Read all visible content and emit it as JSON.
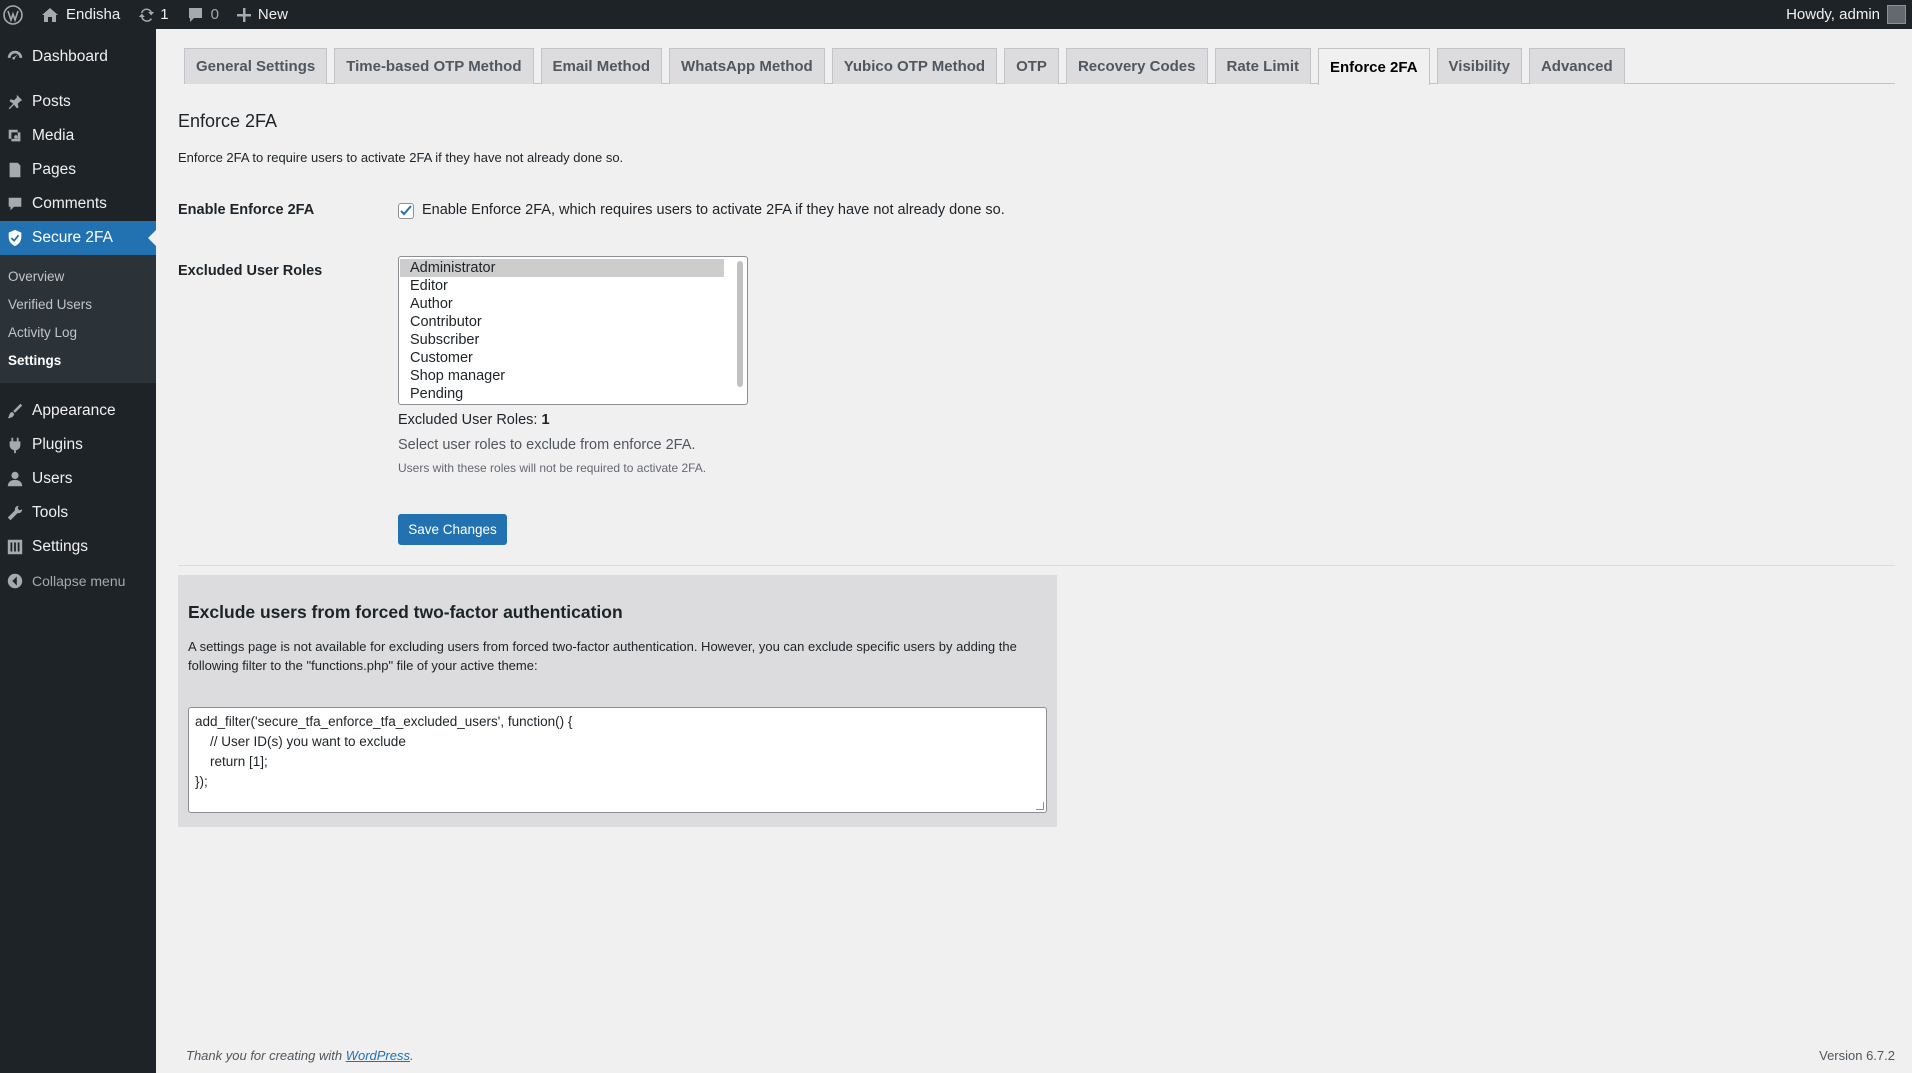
{
  "adminbar": {
    "site_name": "Endisha",
    "updates_count": "1",
    "comments_count": "0",
    "new_label": "New",
    "howdy": "Howdy, admin"
  },
  "sidebar": {
    "dashboard": "Dashboard",
    "posts": "Posts",
    "media": "Media",
    "pages": "Pages",
    "comments": "Comments",
    "secure2fa": "Secure 2FA",
    "sub": [
      "Overview",
      "Verified Users",
      "Activity Log",
      "Settings"
    ],
    "appearance": "Appearance",
    "plugins": "Plugins",
    "users": "Users",
    "tools": "Tools",
    "settings": "Settings",
    "collapse": "Collapse menu"
  },
  "tabs": [
    "General Settings",
    "Time-based OTP Method",
    "Email Method",
    "WhatsApp Method",
    "Yubico OTP Method",
    "OTP",
    "Recovery Codes",
    "Rate Limit",
    "Enforce 2FA",
    "Visibility",
    "Advanced"
  ],
  "main": {
    "title": "Enforce 2FA",
    "description": "Enforce 2FA to require users to activate 2FA if they have not already done so.",
    "enable_label": "Enable Enforce 2FA",
    "enable_checkbox_label": "Enable Enforce 2FA, which requires users to activate 2FA if they have not already done so.",
    "enable_checked": true,
    "excluded_label": "Excluded User Roles",
    "roles": [
      "Administrator",
      "Editor",
      "Author",
      "Contributor",
      "Subscriber",
      "Customer",
      "Shop manager",
      "Pending"
    ],
    "selected_role": "Administrator",
    "excluded_count_label": "Excluded User Roles: ",
    "excluded_count": "1",
    "help_primary": "Select user roles to exclude from enforce 2FA.",
    "help_secondary": "Users with these roles will not be required to activate 2FA.",
    "save_label": "Save Changes"
  },
  "info": {
    "title": "Exclude users from forced two-factor authentication",
    "text": "A settings page is not available for excluding users from forced two-factor authentication. However, you can exclude specific users by adding the following filter to the \"functions.php\" file of your active theme:",
    "code": "add_filter('secure_tfa_enforce_tfa_excluded_users', function() {\n    // User ID(s) you want to exclude\n    return [1];\n});"
  },
  "footer": {
    "thanks_prefix": "Thank you for creating with ",
    "thanks_link": "WordPress",
    "thanks_suffix": ".",
    "version": "Version 6.7.2"
  },
  "colors": {
    "admin_bg": "#1d2327",
    "accent": "#2271b1",
    "page_bg": "#f0f0f1"
  }
}
